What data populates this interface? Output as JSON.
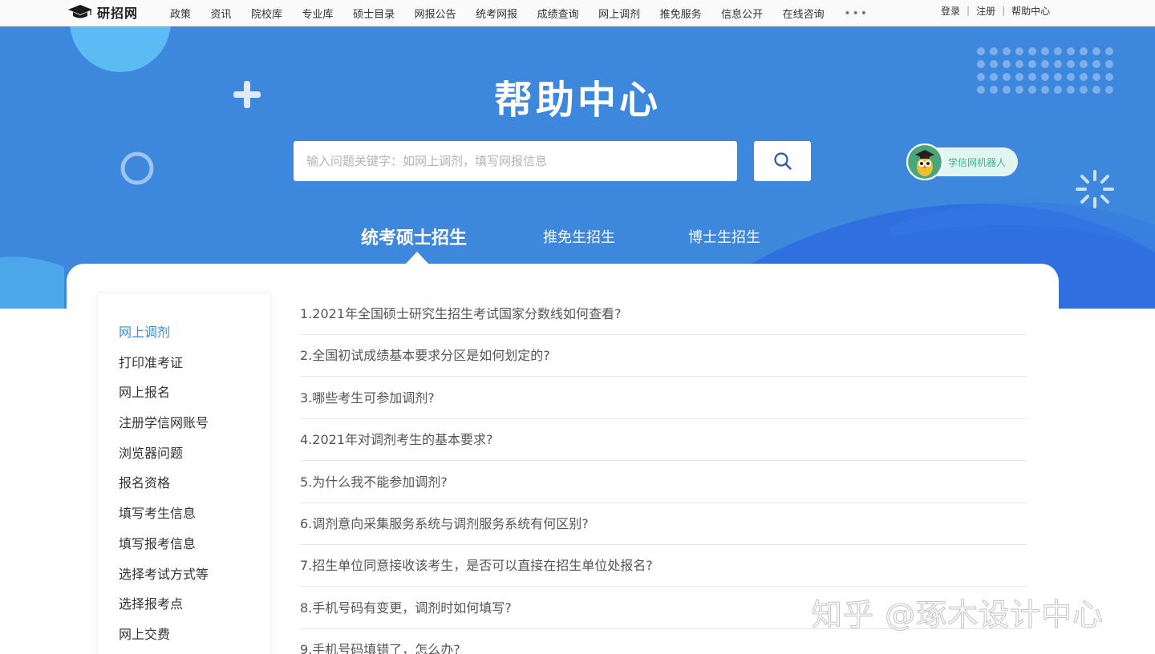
{
  "nav": {
    "logo_text": "研招网",
    "items": [
      "政策",
      "资讯",
      "院校库",
      "专业库",
      "硕士目录",
      "网报公告",
      "统考网报",
      "成绩查询",
      "网上调剂",
      "推免服务",
      "信息公开",
      "在线咨询"
    ],
    "more": "•••",
    "login": "登录",
    "register": "注册",
    "help": "帮助中心",
    "separator": "|"
  },
  "hero": {
    "title": "帮助中心",
    "search_placeholder": "输入问题关键字：如网上调剂，填写网报信息",
    "robot_label": "学信网机器人",
    "tabs": [
      "统考硕士招生",
      "推免生招生",
      "博士生招生"
    ]
  },
  "sidebar": {
    "items": [
      "网上调剂",
      "打印准考证",
      "网上报名",
      "注册学信网账号",
      "浏览器问题",
      "报名资格",
      "填写考生信息",
      "填写报考信息",
      "选择考试方式等",
      "选择报考点",
      "网上交费"
    ]
  },
  "faq": {
    "items": [
      "1.2021年全国硕士研究生招生考试国家分数线如何查看?",
      "2.全国初试成绩基本要求分区是如何划定的?",
      "3.哪些考生可参加调剂?",
      "4.2021年对调剂考生的基本要求?",
      "5.为什么我不能参加调剂?",
      "6.调剂意向采集服务系统与调剂服务系统有何区别?",
      "7.招生单位同意接收该考生，是否可以直接在招生单位处报名?",
      "8.手机号码有变更，调剂时如何填写?",
      "9.手机号码填错了，怎么办?"
    ]
  },
  "watermark": "知乎 @琢木设计中心",
  "colors": {
    "hero_blue": "#3d87dc",
    "accent_blue": "#3b8be0",
    "robot_green": "#3fb58c"
  }
}
